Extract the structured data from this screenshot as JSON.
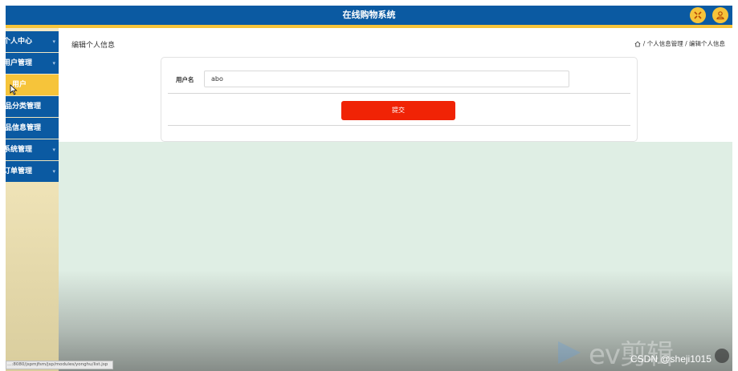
{
  "header": {
    "title": "在线购物系统",
    "buttons": [
      {
        "icon": "fullscreen-icon",
        "color": "#f6c43a"
      },
      {
        "icon": "user-icon",
        "color": "#f6c43a"
      }
    ]
  },
  "sidebar": {
    "items": [
      {
        "label": "个人中心"
      },
      {
        "label": "用户管理"
      },
      {
        "label": "用户",
        "active": true
      },
      {
        "label": "商品分类管理"
      },
      {
        "label": "商品信息管理"
      },
      {
        "label": "系统管理"
      },
      {
        "label": "订单管理"
      }
    ]
  },
  "page": {
    "title": "编辑个人信息",
    "breadcrumb": "/ 个人信息管理 / 编辑个人信息"
  },
  "form": {
    "username_label": "用户名",
    "username_value": "abo",
    "submit_label": "提交"
  },
  "status_url": "…:8080/jspmjfsm/jsp/modules/yonghu/list.jsp",
  "watermark": {
    "logo_text": "ev剪辑",
    "csdn": "CSDN @sheji1015"
  },
  "colors": {
    "primary": "#0b5aa2",
    "accent": "#f6c43a",
    "submit": "#f02305"
  }
}
